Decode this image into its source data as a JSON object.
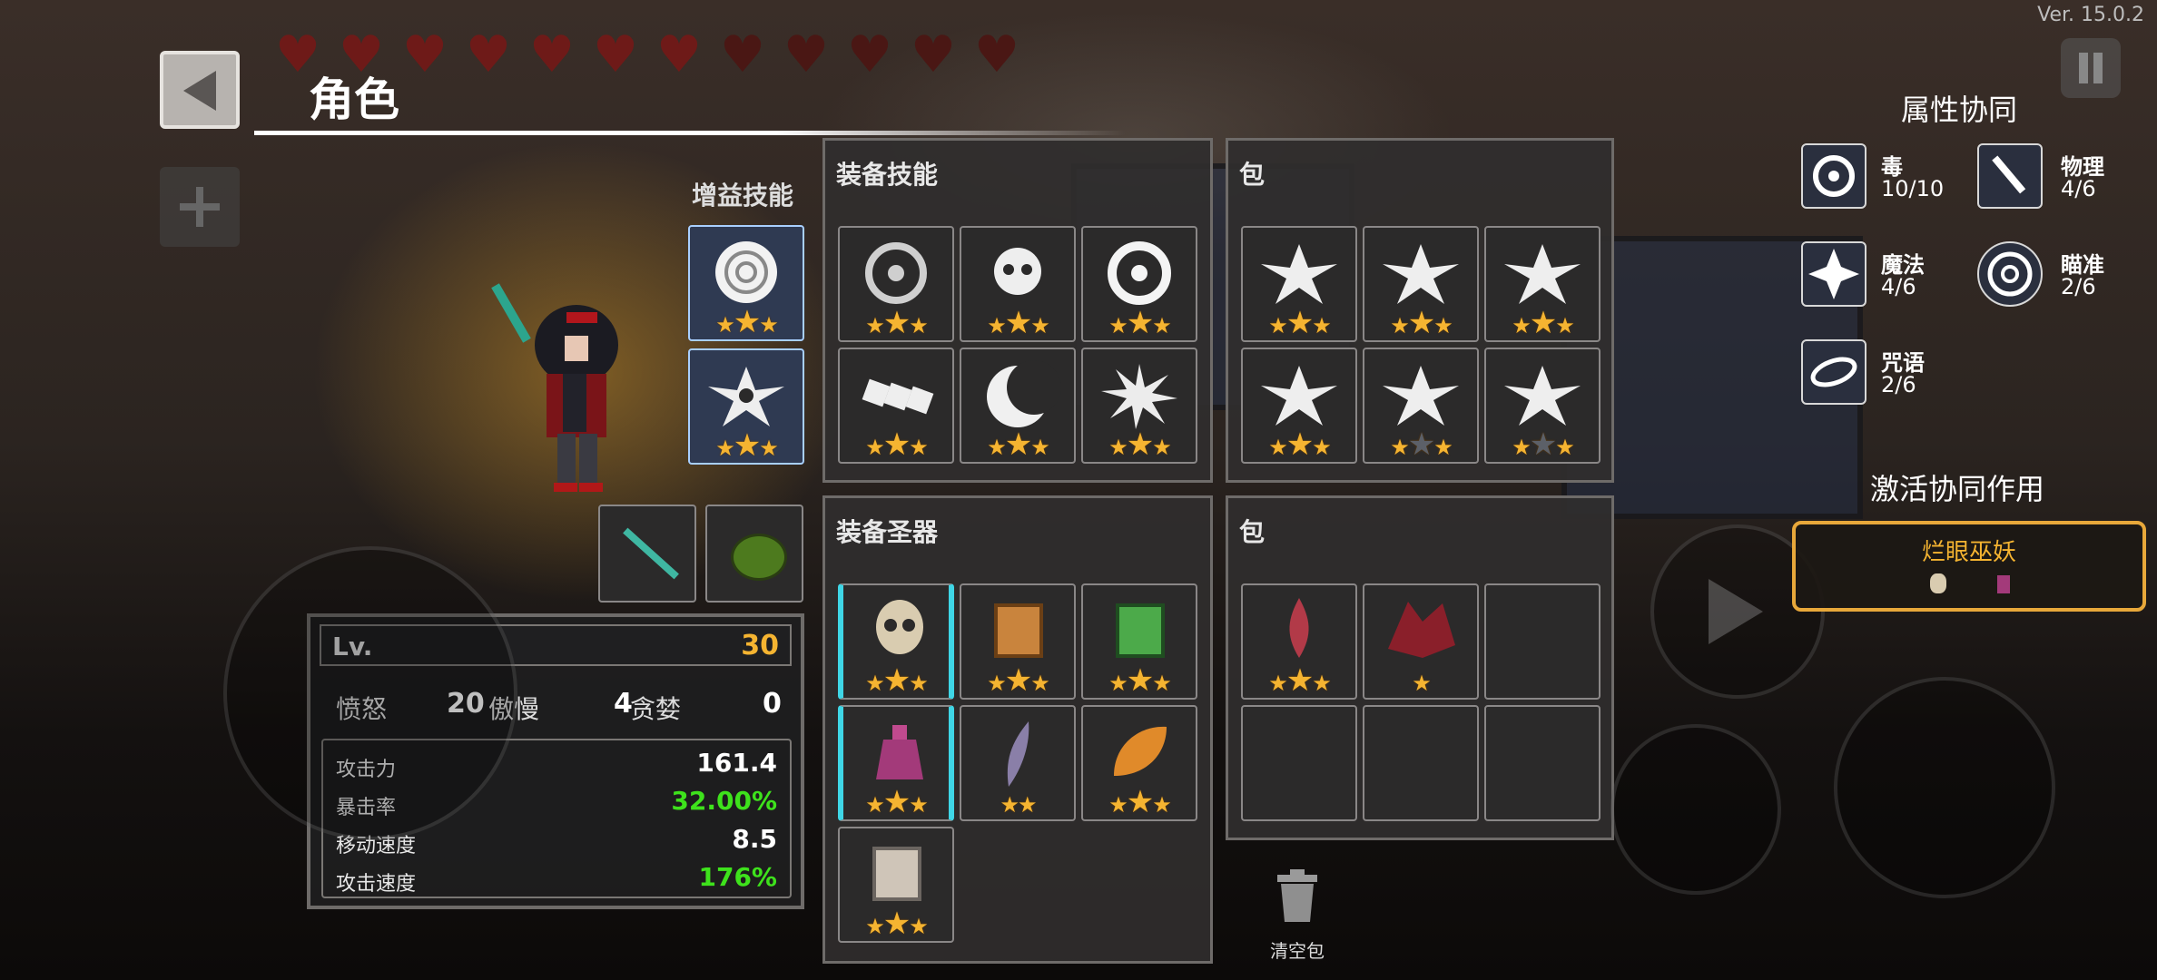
{
  "version": "Ver. 15.0.2",
  "header": {
    "title": "角色"
  },
  "hearts": {
    "total": 12
  },
  "buff_skills": {
    "title": "增益技能",
    "slots": [
      {
        "icon": "rose-shield-icon",
        "stars": "★★★"
      },
      {
        "icon": "biohazard-splash-icon",
        "stars": "★★★"
      }
    ]
  },
  "equipped_skills": {
    "title": "装备技能",
    "slots": [
      {
        "icon": "biohazard-icon",
        "stars": "★★★"
      },
      {
        "icon": "skull-explosion-icon",
        "stars": "★★★"
      },
      {
        "icon": "biohazard-icon",
        "stars": "★★★"
      },
      {
        "icon": "dice-chain-icon",
        "stars": "★★★"
      },
      {
        "icon": "crescent-moon-icon",
        "stars": "★★★"
      },
      {
        "icon": "burst-icon",
        "stars": "★★★"
      }
    ]
  },
  "skill_bag": {
    "title": "包",
    "slots": [
      {
        "icon": "biohazard-splash-icon",
        "stars": "★★★"
      },
      {
        "icon": "biohazard-splash-icon",
        "stars": "★★★"
      },
      {
        "icon": "biohazard-splash-icon",
        "stars": "★★★"
      },
      {
        "icon": "biohazard-splash-icon",
        "stars": "★★★"
      },
      {
        "icon": "biohazard-splash-icon",
        "stars": "★☆★"
      },
      {
        "icon": "biohazard-splash-icon",
        "stars": "★☆★"
      }
    ]
  },
  "equipped_relics": {
    "title": "装备圣器",
    "slots": [
      {
        "icon": "skull-icon",
        "stars": "★★★"
      },
      {
        "icon": "wooden-cube-icon",
        "stars": "★★★"
      },
      {
        "icon": "green-cube-icon",
        "stars": "★★★"
      },
      {
        "icon": "potion-icon",
        "stars": "★★★"
      },
      {
        "icon": "feather-icon",
        "stars": "★★"
      },
      {
        "icon": "golden-leaf-icon",
        "stars": "★★★"
      },
      {
        "icon": "stone-cube-icon",
        "stars": "★★★"
      }
    ]
  },
  "relic_bag": {
    "title": "包",
    "slots": [
      {
        "icon": "red-flame-icon",
        "stars": "★★★"
      },
      {
        "icon": "demon-wing-icon",
        "stars": "★"
      }
    ]
  },
  "weapons": [
    {
      "icon": "green-sword-icon"
    },
    {
      "icon": "pumpkin-icon"
    }
  ],
  "stats": {
    "lv_label": "Lv.",
    "lv_value": "30",
    "anger_label": "愤怒",
    "anger_value": "20",
    "pride_label": "傲慢",
    "pride_value": "4",
    "greed_label": "贪婪",
    "greed_value": "0",
    "rows": [
      {
        "label": "攻击力",
        "value": "161.4",
        "color": "#ffffff"
      },
      {
        "label": "暴击率",
        "value": "32.00%",
        "color": "#3ee21c"
      },
      {
        "label": "移动速度",
        "value": "8.5",
        "color": "#ffffff"
      },
      {
        "label": "攻击速度",
        "value": "176%",
        "color": "#3ee21c"
      }
    ]
  },
  "clear_bag": {
    "label": "清空包"
  },
  "synergy": {
    "title": "属性协同",
    "items": [
      {
        "icon": "biohazard-icon",
        "name": "毒",
        "count": "10/10"
      },
      {
        "icon": "sword-icon",
        "name": "物理",
        "count": "4/6"
      },
      {
        "icon": "magic-star-icon",
        "name": "魔法",
        "count": "4/6"
      },
      {
        "icon": "crosshair-icon",
        "name": "瞄准",
        "count": "2/6"
      },
      {
        "icon": "spell-ring-icon",
        "name": "咒语",
        "count": "2/6"
      }
    ],
    "active_title": "激活协同作用",
    "active_card": {
      "name": "烂眼巫妖"
    }
  }
}
